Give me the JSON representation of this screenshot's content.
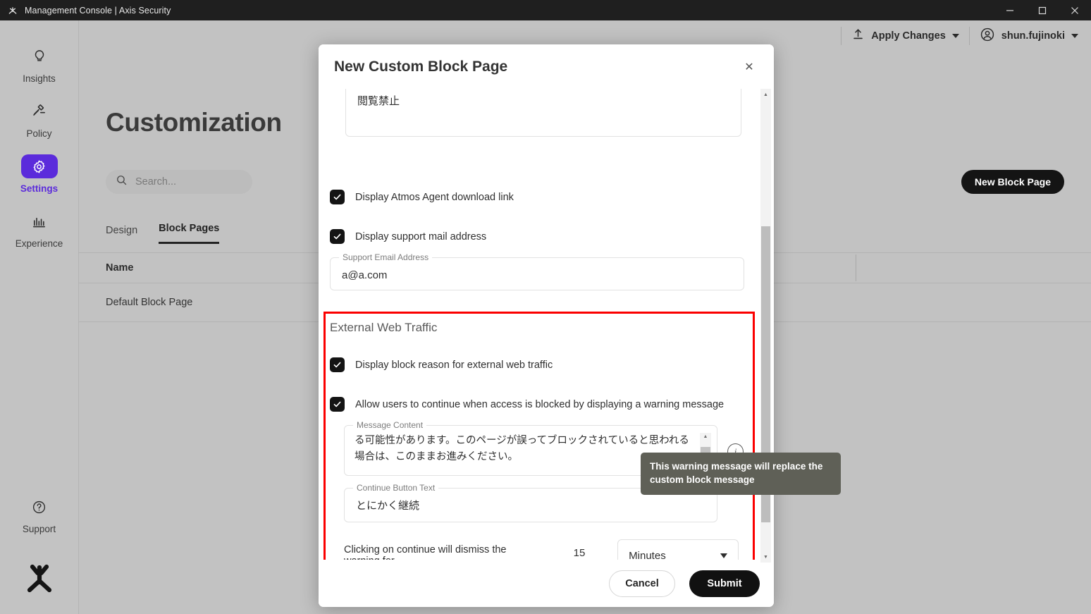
{
  "window": {
    "title": "Management Console | Axis Security",
    "minimize": "—",
    "maximize": "☐",
    "close": "✕"
  },
  "topbar": {
    "apply_changes": "Apply Changes",
    "user": "shun.fujinoki"
  },
  "sidebar": {
    "items": [
      {
        "label": "Insights",
        "icon": "lightbulb-icon",
        "active": false
      },
      {
        "label": "Policy",
        "icon": "gavel-icon",
        "active": false
      },
      {
        "label": "Settings",
        "icon": "gear-icon",
        "active": true
      },
      {
        "label": "Experience",
        "icon": "bar-chart-icon",
        "active": false
      }
    ],
    "support": {
      "label": "Support",
      "icon": "question-circle-icon"
    }
  },
  "page": {
    "title": "Customization",
    "search_placeholder": "Search...",
    "new_block_page_button": "New Block Page",
    "tabs": [
      {
        "label": "Design",
        "active": false
      },
      {
        "label": "Block Pages",
        "active": true
      }
    ],
    "table": {
      "columns": [
        "Name"
      ],
      "rows": [
        [
          "Default Block Page"
        ]
      ]
    }
  },
  "modal": {
    "title": "New Custom Block Page",
    "close_label": "✕",
    "block_message_value": "閲覧禁止",
    "checkbox_atmos": "Display Atmos Agent download link",
    "checkbox_support_mail": "Display support mail address",
    "support_email_label": "Support Email Address",
    "support_email_value": "a@a.com",
    "external_section_title": "External Web Traffic",
    "checkbox_block_reason": "Display block reason for external web traffic",
    "checkbox_allow_continue": "Allow users to continue when access is blocked by displaying a warning message",
    "message_content_label": "Message Content",
    "message_content_value": "る可能性があります。このページが誤ってブロックされていると思われる場合は、このままお進みください。",
    "continue_button_label": "Continue Button Text",
    "continue_button_value": "とにかく継続",
    "dismiss_prefix": "Clicking on continue will dismiss the warning for",
    "dismiss_amount": "15",
    "dismiss_unit": "Minutes",
    "info_icon_char": "i",
    "tooltip": "This warning message will replace the custom block message",
    "cancel": "Cancel",
    "submit": "Submit"
  },
  "colors": {
    "accent_purple": "#5b2bdb",
    "highlight_red": "#fb0000",
    "dark_button": "#111111",
    "tooltip_bg": "#5f6057"
  }
}
